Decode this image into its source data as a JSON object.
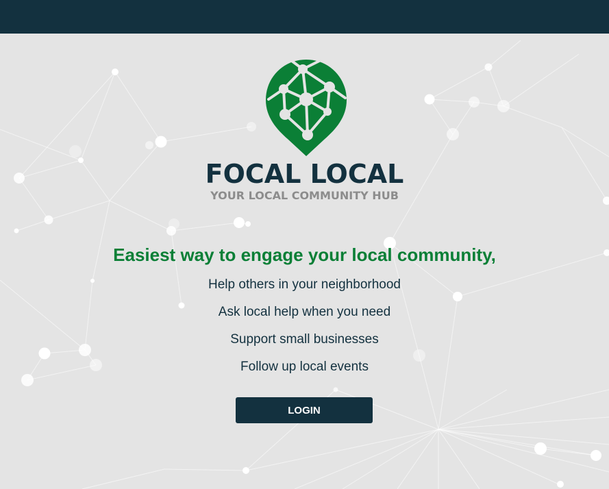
{
  "brand": {
    "name": "FOCAL LOCAL",
    "tagline": "YOUR LOCAL COMMUNITY HUB",
    "logo_icon": "map-pin-network-icon"
  },
  "hero": {
    "headline": "Easiest way to engage your local community,",
    "features": [
      "Help others in your neighborhood",
      "Ask local help when you need",
      "Support small businesses",
      "Follow up local events"
    ]
  },
  "actions": {
    "login_label": "LOGIN"
  },
  "colors": {
    "topbar": "#13313f",
    "background": "#e4e4e4",
    "brand_green": "#0b7f36",
    "brand_dark": "#13313f",
    "tagline_gray": "#8c8c8c",
    "button_bg": "#13313f",
    "button_text": "#ffffff"
  }
}
